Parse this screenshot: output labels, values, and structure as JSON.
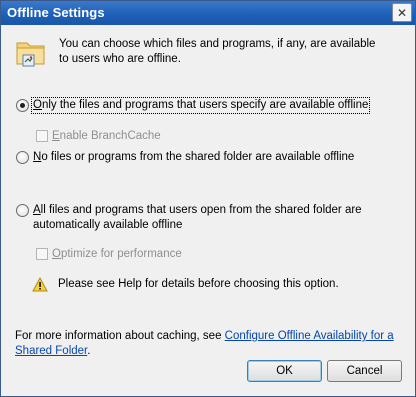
{
  "window": {
    "title": "Offline Settings",
    "close_symbol": "✕"
  },
  "intro": {
    "text": "You can choose which files and programs, if any, are available to users who are offline."
  },
  "options": {
    "specify": {
      "label": "Only the files and programs that users specify are available offline",
      "mnemonic": "O"
    },
    "branchcache": {
      "label": "Enable BranchCache",
      "mnemonic": "E"
    },
    "none": {
      "label": "No files or programs from the shared folder are available offline",
      "mnemonic": "N"
    },
    "all": {
      "label": "All files and programs that users open from the shared folder are automatically available offline",
      "mnemonic": "A"
    },
    "optimize": {
      "label": "Optimize for performance",
      "mnemonic": "O"
    }
  },
  "warning": {
    "text": "Please see Help for details before choosing this option."
  },
  "footer": {
    "prefix": "For more information about caching, see ",
    "link": "Configure Offline Availability for a Shared Folder",
    "suffix": "."
  },
  "buttons": {
    "ok": "OK",
    "cancel": "Cancel"
  },
  "state": {
    "selected_option": "specify",
    "branchcache_checked": false,
    "optimize_checked": false
  }
}
